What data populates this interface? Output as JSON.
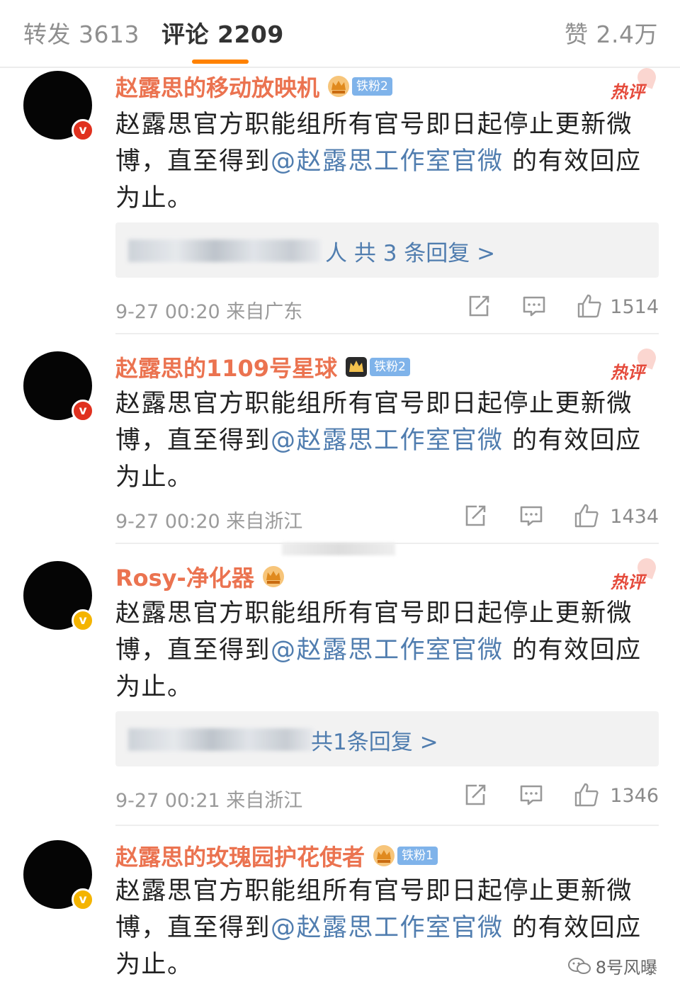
{
  "tabs": {
    "repost": "转发 3613",
    "comments": "评论 2209",
    "likes": "赞 2.4万"
  },
  "hot_label": "热评",
  "comments": [
    {
      "name": "赵露思的移动放映机",
      "fan_badge": "铁粉2",
      "verified": "v",
      "text_before": "赵露思官方职能组所有官号即日起停止更新微博，直至得到",
      "mention": "@赵露思工作室官微",
      "text_after": " 的有效回应为止。",
      "reply_tail": "人  共 3 条回复 >",
      "time": "9-27 00:20  来自广东",
      "like_count": "1514"
    },
    {
      "name": "赵露思的1109号星球",
      "fan_badge": "铁粉2",
      "verified": "v",
      "text_before": "赵露思官方职能组所有官号即日起停止更新微博，直至得到",
      "mention": "@赵露思工作室官微",
      "text_after": " 的有效回应为止。",
      "time": "9-27 00:20  来自浙江",
      "like_count": "1434"
    },
    {
      "name": "Rosy-净化器",
      "verified": "v",
      "text_before": "赵露思官方职能组所有官号即日起停止更新微博，直至得到",
      "mention": "@赵露思工作室官微",
      "text_after": " 的有效回应为止。",
      "reply_tail": "共1条回复 >",
      "time": "9-27 00:21  来自浙江",
      "like_count": "1346"
    },
    {
      "name": "赵露思的玫瑰园护花使者",
      "fan_badge": "铁粉1",
      "verified": "v",
      "text_before": "赵露思官方职能组所有官号即日起停止更新微博，直至得到",
      "mention": "@赵露思工作室官微",
      "text_after": " 的有效回应为止。"
    }
  ],
  "watermark": "8号风曝",
  "colors": {
    "accent": "#ff8200",
    "username": "#eb7350",
    "mention": "#507daf",
    "hot": "#e54a3b"
  }
}
